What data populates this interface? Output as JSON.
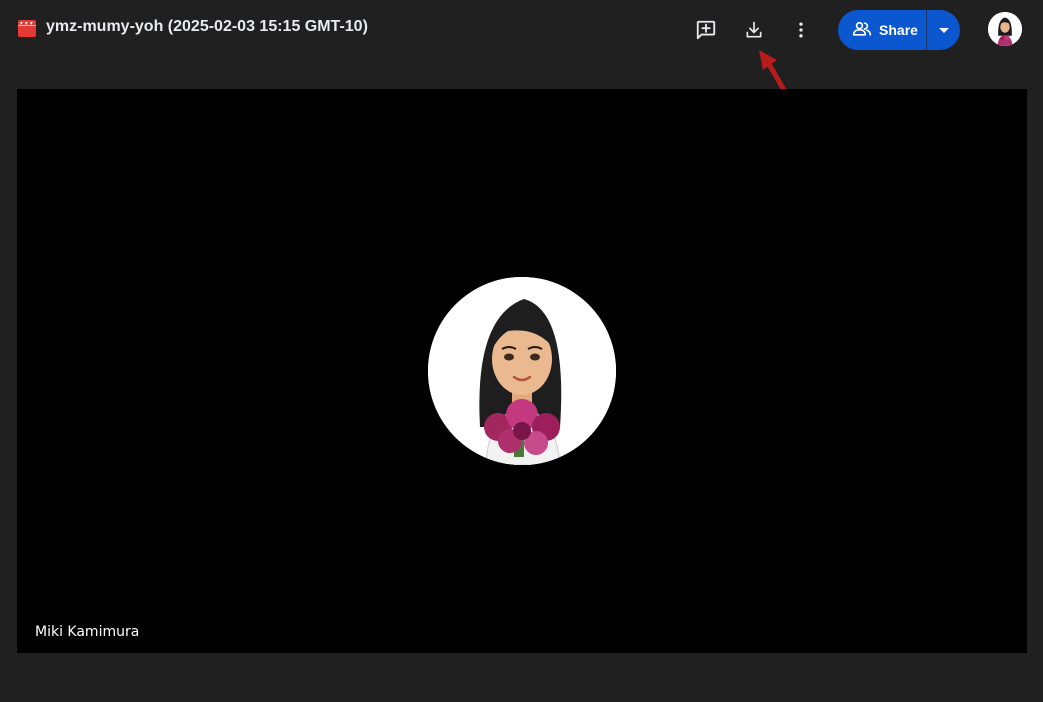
{
  "header": {
    "title": "ymz-mumy-yoh (2025-02-03 15:15 GMT-10)",
    "file_icon": "video-file-icon",
    "actions": [
      {
        "name": "add-comment-icon"
      },
      {
        "name": "download-icon"
      },
      {
        "name": "more-vert-icon"
      }
    ],
    "share": {
      "label": "Share",
      "icon": "people-icon",
      "dropdown_icon": "caret-down-icon"
    },
    "account_icon": "account-avatar"
  },
  "annotation": {
    "type": "red-arrow",
    "points_to": "download-icon",
    "color": "#b71c1c"
  },
  "player": {
    "participant_name": "Miki Kamimura",
    "background": "#000000"
  },
  "colors": {
    "accent": "#0b57d0",
    "background": "#202020",
    "icon": "#e8eaed",
    "file_icon": "#e53935"
  }
}
